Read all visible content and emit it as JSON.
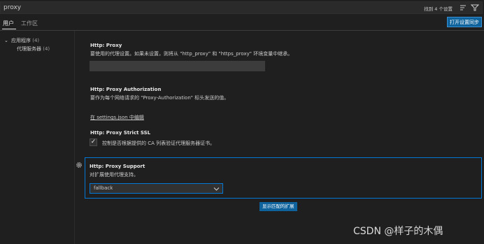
{
  "search": {
    "value": "proxy",
    "result_count": "找到 4 个设置",
    "clear_icon": "clear-filter-icon",
    "filter_icon": "filter-icon"
  },
  "tabs": [
    {
      "label": "用户",
      "active": true
    },
    {
      "label": "工作区",
      "active": false
    }
  ],
  "sync_button": "打开设置同步",
  "tree": [
    {
      "label": "应用程序",
      "count": "(4)",
      "expanded": true
    },
    {
      "label": "代理服务器",
      "count": "(4)"
    }
  ],
  "settings": {
    "proxy": {
      "title": "Http: Proxy",
      "description": "要使用的代理设置。如果未设置，则将从 \"http_proxy\" 和 \"https_proxy\" 环境变量中继承。",
      "value": ""
    },
    "authorization": {
      "title": "Http: Proxy Authorization",
      "description": "要作为每个网络请求的 \"Proxy-Authorization\" 标头发送的值。",
      "link": "在 settings.json 中编辑"
    },
    "strict_ssl": {
      "title": "Http: Proxy Strict SSL",
      "checked": true,
      "label": "控制是否根据提供的 CA 列表验证代理服务器证书。"
    },
    "support": {
      "title": "Http: Proxy Support",
      "description": "对扩展使用代理支持。",
      "selected": "fallback"
    }
  },
  "extensions_button": "显示匹配的扩展",
  "watermark": "CSDN @样子的木偶",
  "colors": {
    "background": "#1f1f1f",
    "accent": "#0078d4",
    "button": "#0e639c"
  }
}
